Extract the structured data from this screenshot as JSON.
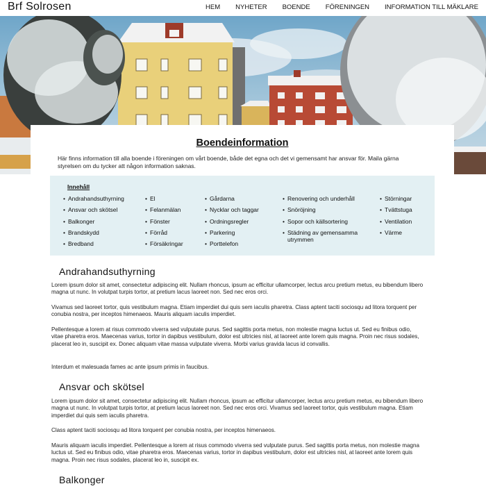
{
  "header": {
    "logo": "Brf Solrosen",
    "nav": [
      "HEM",
      "NYHETER",
      "BOENDE",
      "FÖRENINGEN",
      "INFORMATION TILL MÄKLARE"
    ]
  },
  "hero": {
    "image": "snowy-apartment-buildings-photo"
  },
  "main": {
    "title": "Boendeinformation",
    "intro": "Här finns information till alla boende i föreningen om vårt boende, både det egna och det vi gemensamt har ansvar för. Maila gärna styrelsen om du tycker att någon information saknas.",
    "toc": {
      "title": "Innehåll",
      "columns": [
        [
          "Andrahandsuthyrning",
          "Ansvar och skötsel",
          "Balkonger",
          "Brandskydd",
          "Bredband"
        ],
        [
          "El",
          "Felanmälan",
          "Fönster",
          "Förråd",
          "Försäkringar"
        ],
        [
          "Gårdarna",
          "Nycklar och taggar",
          "Ordningsregler",
          "Parkering",
          "Porttelefon"
        ],
        [
          "Renovering och underhåll",
          "Snöröjning",
          "Sopor och källsortering",
          "Städning av gemensamma utrymmen"
        ],
        [
          "Störningar",
          "Tvättstuga",
          "Ventilation",
          "Värme"
        ]
      ]
    },
    "sections": [
      {
        "heading": "Andrahandsuthyrning",
        "paragraphs": [
          "Lorem ipsum dolor sit amet, consectetur adipiscing elit. Nullam rhoncus, ipsum ac efficitur ullamcorper, lectus arcu pretium metus, eu bibendum libero magna ut nunc. In volutpat turpis tortor, at pretium lacus laoreet non. Sed nec eros orci.",
          "Vivamus sed laoreet tortor, quis vestibulum magna. Etiam imperdiet dui quis sem iaculis pharetra. Class aptent taciti sociosqu ad litora torquent per conubia nostra, per inceptos himenaeos. Mauris aliquam iaculis imperdiet.",
          "Pellentesque a lorem at risus commodo viverra sed vulputate purus. Sed sagittis porta metus, non molestie magna luctus ut. Sed eu finibus odio, vitae pharetra eros. Maecenas varius, tortor in dapibus vestibulum, dolor est ultricies nisl, at laoreet ante lorem quis magna. Proin nec risus sodales, placerat leo in, suscipit ex. Donec aliquam vitae massa vulputate viverra. Morbi varius gravida lacus id convallis.",
          "Interdum et malesuada fames ac ante ipsum primis in faucibus."
        ]
      },
      {
        "heading": "Ansvar och skötsel",
        "paragraphs": [
          "Lorem ipsum dolor sit amet, consectetur adipiscing elit. Nullam rhoncus, ipsum ac efficitur ullamcorper, lectus arcu pretium metus, eu bibendum libero magna ut nunc. In volutpat turpis tortor, at pretium lacus laoreet non. Sed nec eros orci. Vivamus sed laoreet tortor, quis vestibulum magna. Etiam imperdiet dui quis sem iaculis pharetra.",
          "Class aptent taciti sociosqu ad litora torquent per conubia nostra, per inceptos himenaeos.",
          "Mauris aliquam iaculis imperdiet. Pellentesque a lorem at risus commodo viverra sed vulputate purus. Sed sagittis porta metus, non molestie magna luctus ut. Sed eu finibus odio, vitae pharetra eros. Maecenas varius, tortor in dapibus vestibulum, dolor est ultricies nisl, at laoreet ante lorem quis magna. Proin nec risus sodales, placerat leo in, suscipit ex."
        ]
      },
      {
        "heading": "Balkonger",
        "paragraphs": []
      }
    ]
  }
}
